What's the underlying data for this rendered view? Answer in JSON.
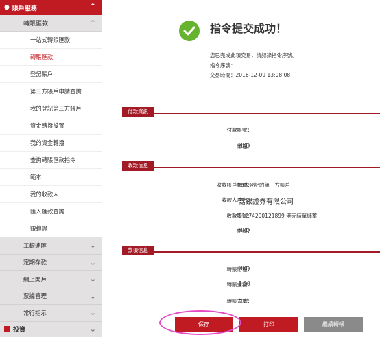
{
  "sidebar": {
    "header": "賬戶服務",
    "group": "轉賬匯款",
    "items": [
      {
        "label": "一站式轉賬匯款"
      },
      {
        "label": "轉賬匯款",
        "active": true
      },
      {
        "label": "登記賬戶"
      },
      {
        "label": "第三方賬戶申請查詢"
      },
      {
        "label": "我的登記第三方賬戶"
      },
      {
        "label": "資金轉撥設置"
      },
      {
        "label": "我的資金轉撥"
      },
      {
        "label": "查詢轉賬匯款指令"
      },
      {
        "label": "範本"
      },
      {
        "label": "我的收款人"
      },
      {
        "label": "匯入匯款查詢"
      },
      {
        "label": "銀轉證"
      }
    ],
    "categories": [
      {
        "label": "工銀速匯"
      },
      {
        "label": "定期存款"
      },
      {
        "label": "網上開戶"
      },
      {
        "label": "票據管理"
      },
      {
        "label": "常行指示"
      }
    ],
    "bottom": "投資"
  },
  "main": {
    "title": "指令提交成功！",
    "info_line": "您已完成此項交易，請記錄指令序號。",
    "order_label": "指令序號：",
    "time_label": "交易時間：",
    "time_value": "2016-12-09 13:08:08",
    "sections": {
      "payment": {
        "title": "付款資訊",
        "rows": [
          {
            "label": "付款賬號：",
            "value": ""
          },
          {
            "label": "幣種：",
            "value": "HKD"
          }
        ]
      },
      "receipt": {
        "title": "收款信息",
        "rows": [
          {
            "label": "收款賬戶類別：",
            "value": "預先登記的第三方賬戶"
          },
          {
            "label": "收款人戶名：",
            "value": "嘉銀證券有限公司"
          },
          {
            "label": "收款賬號：",
            "value": "01274200121899 港元結單儲蓄"
          },
          {
            "label": "幣種：",
            "value": "HKD"
          }
        ]
      },
      "funds": {
        "title": "款項信息",
        "rows": [
          {
            "label": "轉賬幣種：",
            "value": "HKD"
          },
          {
            "label": "轉賬金額：",
            "value": "1.00"
          },
          {
            "label": "轉賬方式：",
            "value": "即時"
          }
        ]
      }
    },
    "buttons": {
      "save": "保存",
      "print": "打印",
      "continue": "繼續轉帳"
    }
  }
}
